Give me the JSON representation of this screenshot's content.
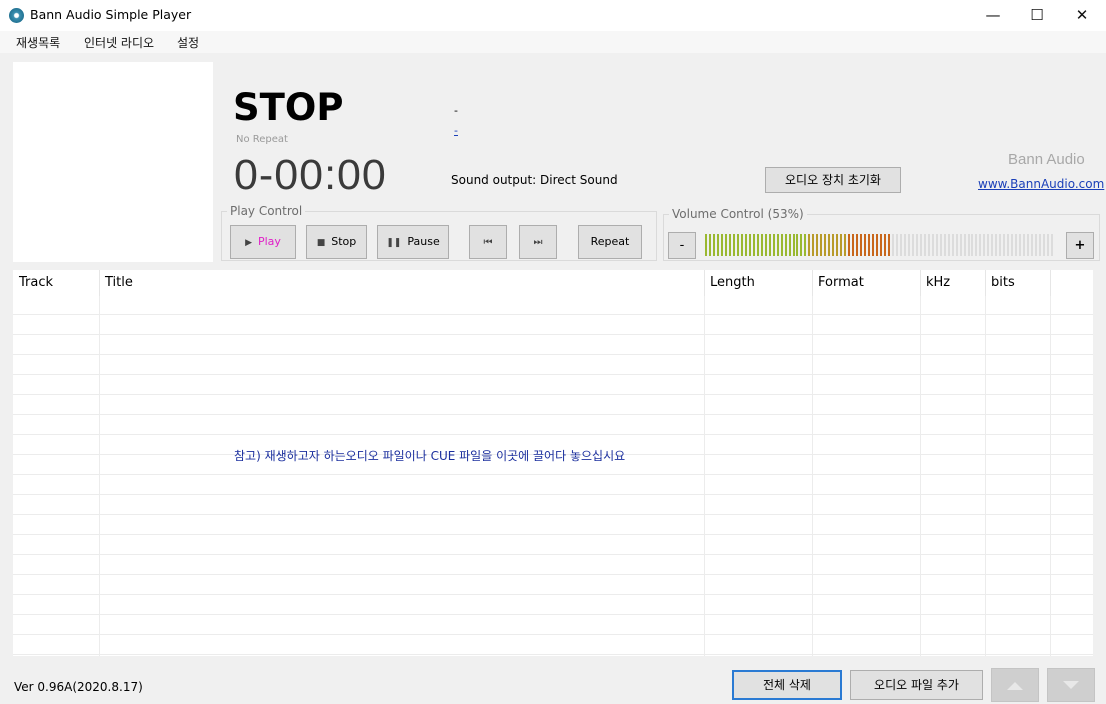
{
  "window": {
    "title": "Bann Audio Simple Player",
    "minimize_glyph": "—",
    "maximize_glyph": "☐",
    "close_glyph": "✕"
  },
  "menu": {
    "items": [
      "재생목록",
      "인터넷 라디오",
      "설정"
    ]
  },
  "player": {
    "status": "STOP",
    "repeat_mode": "No Repeat",
    "time": "0-00:00",
    "info_line1": "-",
    "info_line2": "-",
    "sound_output": "Sound output: Direct Sound",
    "reset_device_label": "오디오 장치 초기화",
    "brand": "Bann Audio",
    "brand_link": "www.BannAudio.com"
  },
  "play_control": {
    "label": "Play Control",
    "play": "Play",
    "stop": "Stop",
    "pause": "Pause",
    "repeat": "Repeat"
  },
  "volume": {
    "label": "Volume Control (53%)",
    "level_percent": 53,
    "minus": "-",
    "plus": "+"
  },
  "playlist": {
    "columns": [
      "Track",
      "Title",
      "Length",
      "Format",
      "kHz",
      "bits"
    ],
    "hint": "참고) 재생하고자 하는오디오 파일이나 CUE 파일을 이곳에 끌어다 놓으십시요"
  },
  "footer": {
    "version": "Ver 0.96A(2020.8.17)",
    "delete_all": "전체 삭제",
    "add_file": "오디오 파일 추가"
  },
  "colors": {
    "play_accent": "#e01fc8",
    "link": "#1a3fb8",
    "hint": "#1b2f9e",
    "vol_green": "#9ab830",
    "vol_orange": "#c8661a"
  }
}
